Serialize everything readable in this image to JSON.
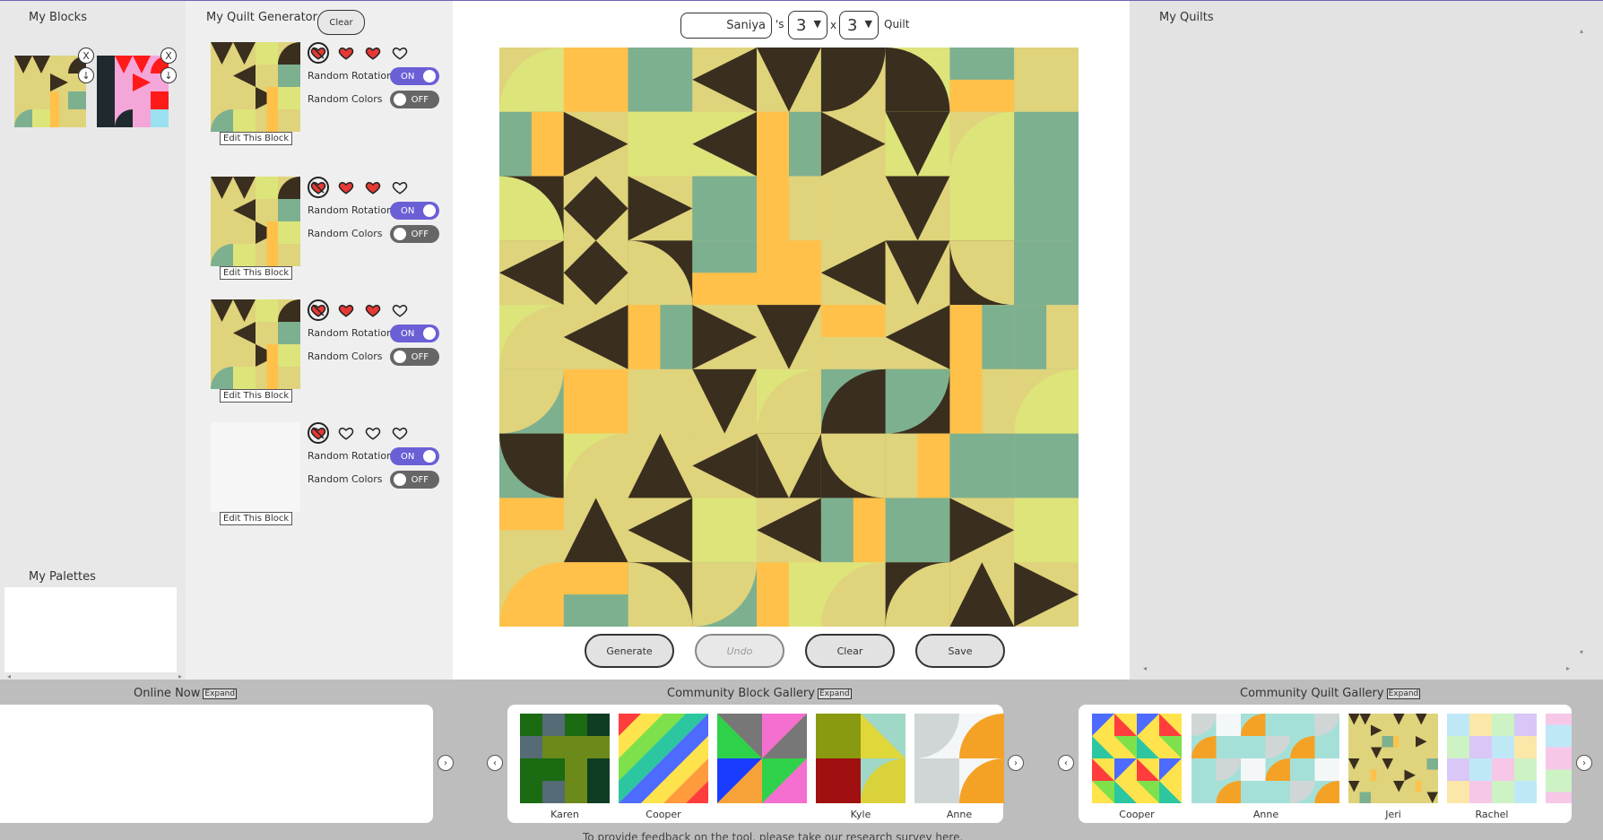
{
  "left": {
    "my_blocks_title": "My Blocks",
    "remove_glyph": "X",
    "download_glyph": "↓",
    "my_palettes_title": "My Palettes"
  },
  "generator": {
    "title": "My Quilt Generator",
    "clear_label": "Clear",
    "random_rotation_label": "Random Rotation",
    "random_colors_label": "Random Colors",
    "edit_label": "Edit This Block",
    "on_label": "ON",
    "off_label": "OFF",
    "rows": [
      {
        "likes_filled": 2
      },
      {
        "likes_filled": 2
      },
      {
        "likes_filled": 2
      },
      {
        "likes_filled": 0
      }
    ]
  },
  "header": {
    "name_value": "Saniya",
    "possessive": "'s",
    "cols_value": "3",
    "times": "x",
    "rows_value": "3",
    "quilt_word": "Quilt"
  },
  "actions": {
    "generate": "Generate",
    "undo": "Undo",
    "clear": "Clear",
    "save": "Save"
  },
  "right": {
    "my_quilts_title": "My Quilts"
  },
  "bottom": {
    "online_now_title": "Online Now",
    "block_gallery_title": "Community Block Gallery",
    "quilt_gallery_title": "Community Quilt Gallery",
    "expand_label": "Expand",
    "block_gallery_names": [
      "Karen",
      "Cooper",
      "Kyle",
      "Anne"
    ],
    "quilt_gallery_names": [
      "Cooper",
      "Anne",
      "Jeri",
      "Rachel"
    ],
    "feedback_text": "To provide feedback on the tool, please take our research survey here."
  },
  "colors": {
    "dark": "#3a2e1f",
    "yellow": "#dfd37c",
    "lime": "#dde47a",
    "orange": "#ffc14a",
    "sage": "#7db08f",
    "accent": "#6b5fd6"
  }
}
